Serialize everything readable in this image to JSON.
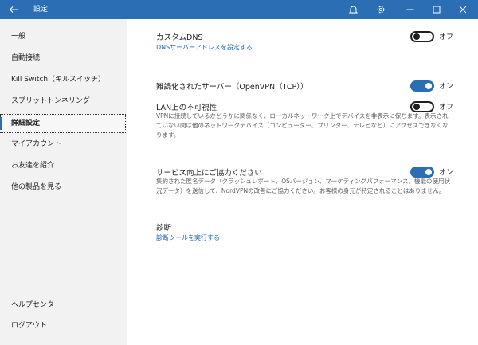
{
  "window": {
    "title": "設定"
  },
  "sidebar": {
    "items": [
      {
        "label": "一般"
      },
      {
        "label": "自動接続"
      },
      {
        "label": "Kill Switch（キルスイッチ）"
      },
      {
        "label": "スプリットトンネリング"
      },
      {
        "label": "詳細設定"
      },
      {
        "label": "マイアカウント"
      },
      {
        "label": "お友達を紹介"
      },
      {
        "label": "他の製品を見る"
      }
    ],
    "footer": [
      {
        "label": "ヘルプセンター"
      },
      {
        "label": "ログアウト"
      }
    ]
  },
  "settings": {
    "custom_dns": {
      "title": "カスタムDNS",
      "link": "DNSサーバーアドレスを設定する",
      "state": "オフ"
    },
    "obfuscated": {
      "title": "難読化されたサーバー（OpenVPN（TCP））",
      "state": "オン"
    },
    "lan_invisibility": {
      "title": "LAN上の不可視性",
      "description": "VPNに接続しているかどうかに関係なく、ローカルネットワーク上でデバイスを非表示に保ちます。表示されていない間は他のネットワークデバイス（コンピューター、プリンター、テレビなど）にアクセスできなくなります。",
      "state": "オフ"
    },
    "analytics": {
      "title": "サービス向上にご協力ください",
      "description": "集約された匿名データ（クラッシュレポート、OSバージョン、マーケティングパフォーマンス、機能の使用状況データ）を送信して、NordVPNの改善にご協力ください。お客様の身元が特定されることはありません。",
      "state": "オン"
    },
    "diagnostics": {
      "title": "診断",
      "link": "診断ツールを実行する"
    }
  },
  "icons": {
    "back": "back-arrow-icon",
    "bell": "bell-icon",
    "gear": "gear-icon",
    "minimize": "minimize-icon",
    "maximize": "maximize-icon",
    "close": "close-icon"
  },
  "colors": {
    "titlebar": "#2b6eb4",
    "accent": "#2b6eb4",
    "link": "#1d63b0",
    "sidebar_bg": "#f2f2f2"
  }
}
